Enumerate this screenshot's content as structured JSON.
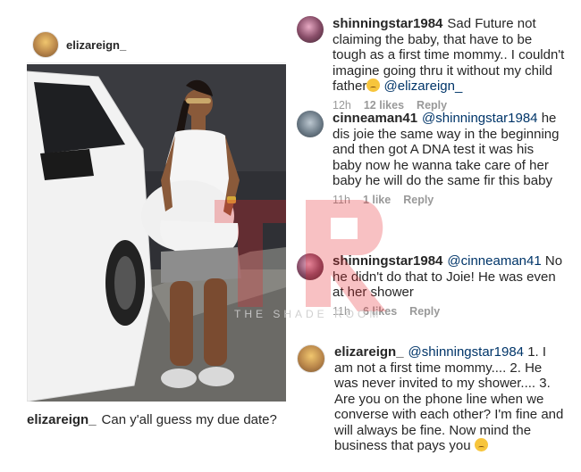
{
  "post": {
    "username": "elizareign_",
    "caption_user": "elizareign_",
    "caption_text": "Can y'all guess my due date?"
  },
  "comments": [
    {
      "username": "shinningstar1984",
      "text": "Sad Future not claiming the baby, that have to be tough as a first time mommy.. I couldn't imagine going thru it without my child father",
      "mention_after": "@elizareign_",
      "emoji": "sad-face-emoji",
      "time": "12h",
      "likes": "12 likes",
      "reply": "Reply"
    },
    {
      "username": "cinneaman41",
      "mention": "@shinningstar1984",
      "text": "he dis joie the same way in the beginning and then got A DNA test it was his baby now he wanna take care of her baby he will do the same fir this baby",
      "time": "11h",
      "likes": "1 like",
      "reply": "Reply"
    },
    {
      "username": "shinningstar1984",
      "mention": "@cinneaman41",
      "text": "No he didn't do that to Joie! He was even at her shower",
      "time": "11h",
      "likes": "6 likes",
      "reply": "Reply"
    },
    {
      "username": "elizareign_",
      "mention": "@shinningstar1984",
      "text": "1. I am not a first time mommy.... 2. He was never invited to my shower.... 3. Are you on the phone line when we converse with each other? I'm fine and will always be fine. Now mind the business that pays you",
      "emoji": "kiss-face-emoji"
    }
  ],
  "watermark": {
    "letters": "TR",
    "text": "THE SHADE ROOM"
  },
  "colors": {
    "username": "#262626",
    "mention": "#003569",
    "meta": "#999999",
    "watermark": "#e8262b"
  }
}
